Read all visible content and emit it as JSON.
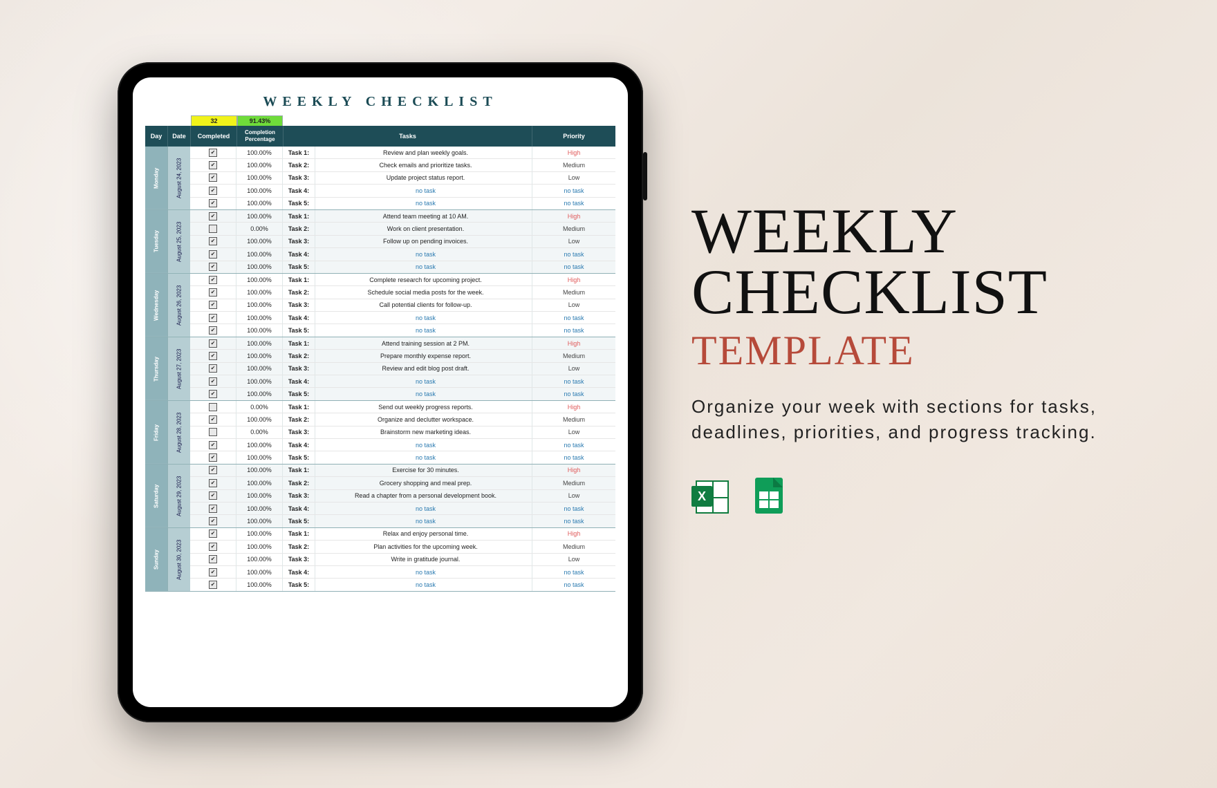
{
  "marketing": {
    "headline_line1": "WEEKLY",
    "headline_line2": "CHECKLIST",
    "subhead": "TEMPLATE",
    "blurb": "Organize your week with sections for tasks, deadlines, priorities, and progress tracking."
  },
  "sheet": {
    "title": "WEEKLY CHECKLIST",
    "summary": {
      "count": "32",
      "percent": "91.43%"
    },
    "headers": {
      "day": "Day",
      "date": "Date",
      "completed": "Completed",
      "pct1": "Completion",
      "pct2": "Percentage",
      "tasks": "Tasks",
      "priority": "Priority"
    },
    "days": [
      {
        "day": "Monday",
        "date": "August 24, 2023",
        "tasks": [
          {
            "done": true,
            "pct": "100.00%",
            "label": "Task 1:",
            "desc": "Review and plan weekly goals.",
            "priority": "High"
          },
          {
            "done": true,
            "pct": "100.00%",
            "label": "Task 2:",
            "desc": "Check emails and prioritize tasks.",
            "priority": "Medium"
          },
          {
            "done": true,
            "pct": "100.00%",
            "label": "Task 3:",
            "desc": "Update project status report.",
            "priority": "Low"
          },
          {
            "done": true,
            "pct": "100.00%",
            "label": "Task 4:",
            "desc": "no task",
            "priority": "no task"
          },
          {
            "done": true,
            "pct": "100.00%",
            "label": "Task 5:",
            "desc": "no task",
            "priority": "no task"
          }
        ]
      },
      {
        "day": "Tuesday",
        "date": "August 25, 2023",
        "tasks": [
          {
            "done": true,
            "pct": "100.00%",
            "label": "Task 1:",
            "desc": "Attend team meeting at 10 AM.",
            "priority": "High"
          },
          {
            "done": false,
            "pct": "0.00%",
            "label": "Task 2:",
            "desc": "Work on client presentation.",
            "priority": "Medium"
          },
          {
            "done": true,
            "pct": "100.00%",
            "label": "Task 3:",
            "desc": "Follow up on pending invoices.",
            "priority": "Low"
          },
          {
            "done": true,
            "pct": "100.00%",
            "label": "Task 4:",
            "desc": "no task",
            "priority": "no task"
          },
          {
            "done": true,
            "pct": "100.00%",
            "label": "Task 5:",
            "desc": "no task",
            "priority": "no task"
          }
        ]
      },
      {
        "day": "Wednesday",
        "date": "August 26, 2023",
        "tasks": [
          {
            "done": true,
            "pct": "100.00%",
            "label": "Task 1:",
            "desc": "Complete research for upcoming project.",
            "priority": "High"
          },
          {
            "done": true,
            "pct": "100.00%",
            "label": "Task 2:",
            "desc": "Schedule social media posts for the week.",
            "priority": "Medium"
          },
          {
            "done": true,
            "pct": "100.00%",
            "label": "Task 3:",
            "desc": "Call potential clients for follow-up.",
            "priority": "Low"
          },
          {
            "done": true,
            "pct": "100.00%",
            "label": "Task 4:",
            "desc": "no task",
            "priority": "no task"
          },
          {
            "done": true,
            "pct": "100.00%",
            "label": "Task 5:",
            "desc": "no task",
            "priority": "no task"
          }
        ]
      },
      {
        "day": "Thursday",
        "date": "August 27, 2023",
        "tasks": [
          {
            "done": true,
            "pct": "100.00%",
            "label": "Task 1:",
            "desc": "Attend training session at 2 PM.",
            "priority": "High"
          },
          {
            "done": true,
            "pct": "100.00%",
            "label": "Task 2:",
            "desc": "Prepare monthly expense report.",
            "priority": "Medium"
          },
          {
            "done": true,
            "pct": "100.00%",
            "label": "Task 3:",
            "desc": "Review and edit blog post draft.",
            "priority": "Low"
          },
          {
            "done": true,
            "pct": "100.00%",
            "label": "Task 4:",
            "desc": "no task",
            "priority": "no task"
          },
          {
            "done": true,
            "pct": "100.00%",
            "label": "Task 5:",
            "desc": "no task",
            "priority": "no task"
          }
        ]
      },
      {
        "day": "Friday",
        "date": "August 28, 2023",
        "tasks": [
          {
            "done": false,
            "pct": "0.00%",
            "label": "Task 1:",
            "desc": "Send out weekly progress reports.",
            "priority": "High"
          },
          {
            "done": true,
            "pct": "100.00%",
            "label": "Task 2:",
            "desc": "Organize and declutter workspace.",
            "priority": "Medium"
          },
          {
            "done": false,
            "pct": "0.00%",
            "label": "Task 3:",
            "desc": "Brainstorm new marketing ideas.",
            "priority": "Low"
          },
          {
            "done": true,
            "pct": "100.00%",
            "label": "Task 4:",
            "desc": "no task",
            "priority": "no task"
          },
          {
            "done": true,
            "pct": "100.00%",
            "label": "Task 5:",
            "desc": "no task",
            "priority": "no task"
          }
        ]
      },
      {
        "day": "Saturday",
        "date": "August 29, 2023",
        "tasks": [
          {
            "done": true,
            "pct": "100.00%",
            "label": "Task 1:",
            "desc": "Exercise for 30 minutes.",
            "priority": "High"
          },
          {
            "done": true,
            "pct": "100.00%",
            "label": "Task 2:",
            "desc": "Grocery shopping and meal prep.",
            "priority": "Medium"
          },
          {
            "done": true,
            "pct": "100.00%",
            "label": "Task 3:",
            "desc": "Read a chapter from a personal development book.",
            "priority": "Low"
          },
          {
            "done": true,
            "pct": "100.00%",
            "label": "Task 4:",
            "desc": "no task",
            "priority": "no task"
          },
          {
            "done": true,
            "pct": "100.00%",
            "label": "Task 5:",
            "desc": "no task",
            "priority": "no task"
          }
        ]
      },
      {
        "day": "Sunday",
        "date": "August 30, 2023",
        "tasks": [
          {
            "done": true,
            "pct": "100.00%",
            "label": "Task 1:",
            "desc": "Relax and enjoy personal time.",
            "priority": "High"
          },
          {
            "done": true,
            "pct": "100.00%",
            "label": "Task 2:",
            "desc": "Plan activities for the upcoming week.",
            "priority": "Medium"
          },
          {
            "done": true,
            "pct": "100.00%",
            "label": "Task 3:",
            "desc": "Write in gratitude journal.",
            "priority": "Low"
          },
          {
            "done": true,
            "pct": "100.00%",
            "label": "Task 4:",
            "desc": "no task",
            "priority": "no task"
          },
          {
            "done": true,
            "pct": "100.00%",
            "label": "Task 5:",
            "desc": "no task",
            "priority": "no task"
          }
        ]
      }
    ]
  }
}
